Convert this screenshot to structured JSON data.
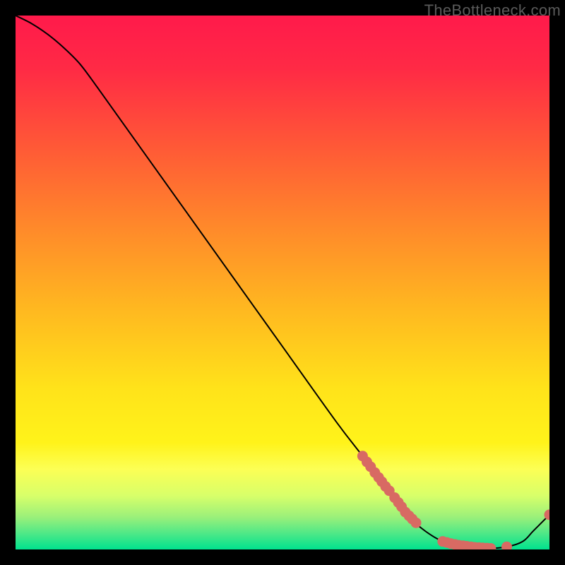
{
  "watermark": "TheBottleneck.com",
  "chart_data": {
    "type": "line",
    "title": "",
    "xlabel": "",
    "ylabel": "",
    "xlim": [
      0,
      100
    ],
    "ylim": [
      0,
      100
    ],
    "gradient_stops": [
      {
        "pos": 0.0,
        "color": "#ff1a4b"
      },
      {
        "pos": 0.1,
        "color": "#ff2a45"
      },
      {
        "pos": 0.25,
        "color": "#ff5a36"
      },
      {
        "pos": 0.4,
        "color": "#ff8a2a"
      },
      {
        "pos": 0.55,
        "color": "#ffb820"
      },
      {
        "pos": 0.7,
        "color": "#ffe31a"
      },
      {
        "pos": 0.8,
        "color": "#fff31a"
      },
      {
        "pos": 0.85,
        "color": "#fcff55"
      },
      {
        "pos": 0.9,
        "color": "#d7ff6a"
      },
      {
        "pos": 0.94,
        "color": "#99f07a"
      },
      {
        "pos": 0.97,
        "color": "#4ee887"
      },
      {
        "pos": 1.0,
        "color": "#00e28e"
      }
    ],
    "series": [
      {
        "name": "bottleneck-curve",
        "x": [
          0,
          3,
          6,
          9,
          12,
          15,
          20,
          30,
          40,
          50,
          60,
          65,
          70,
          73,
          76,
          80,
          84,
          88,
          92,
          95,
          97,
          100
        ],
        "y": [
          100,
          98.5,
          96.5,
          94.0,
          91.0,
          87.0,
          80.0,
          66.0,
          52.0,
          38.0,
          24.0,
          17.5,
          11.0,
          7.0,
          4.0,
          1.5,
          0.5,
          0.2,
          0.5,
          1.5,
          3.5,
          6.5
        ]
      }
    ],
    "marker_clusters": [
      {
        "name": "cluster-upper",
        "color": "#d86a63",
        "points": [
          {
            "x": 65.0,
            "y": 17.5
          },
          {
            "x": 65.8,
            "y": 16.4
          },
          {
            "x": 66.5,
            "y": 15.5
          },
          {
            "x": 67.3,
            "y": 14.4
          },
          {
            "x": 68.0,
            "y": 13.5
          },
          {
            "x": 68.6,
            "y": 12.7
          },
          {
            "x": 69.3,
            "y": 11.8
          },
          {
            "x": 70.0,
            "y": 11.0
          },
          {
            "x": 71.0,
            "y": 9.7
          },
          {
            "x": 71.7,
            "y": 8.8
          },
          {
            "x": 72.3,
            "y": 8.0
          },
          {
            "x": 73.0,
            "y": 7.0
          },
          {
            "x": 73.7,
            "y": 6.3
          },
          {
            "x": 74.3,
            "y": 5.7
          },
          {
            "x": 75.0,
            "y": 5.0
          }
        ]
      },
      {
        "name": "cluster-lower",
        "color": "#d86a63",
        "points": [
          {
            "x": 80.0,
            "y": 1.5
          },
          {
            "x": 80.8,
            "y": 1.3
          },
          {
            "x": 81.5,
            "y": 1.1
          },
          {
            "x": 82.3,
            "y": 0.95
          },
          {
            "x": 83.0,
            "y": 0.8
          },
          {
            "x": 83.8,
            "y": 0.7
          },
          {
            "x": 84.5,
            "y": 0.6
          },
          {
            "x": 85.3,
            "y": 0.5
          },
          {
            "x": 86.0,
            "y": 0.4
          },
          {
            "x": 86.8,
            "y": 0.35
          },
          {
            "x": 87.5,
            "y": 0.3
          },
          {
            "x": 88.3,
            "y": 0.25
          },
          {
            "x": 89.0,
            "y": 0.2
          },
          {
            "x": 92.0,
            "y": 0.5
          }
        ]
      },
      {
        "name": "end-marker",
        "color": "#d86a63",
        "points": [
          {
            "x": 100.0,
            "y": 6.5
          }
        ]
      }
    ]
  }
}
